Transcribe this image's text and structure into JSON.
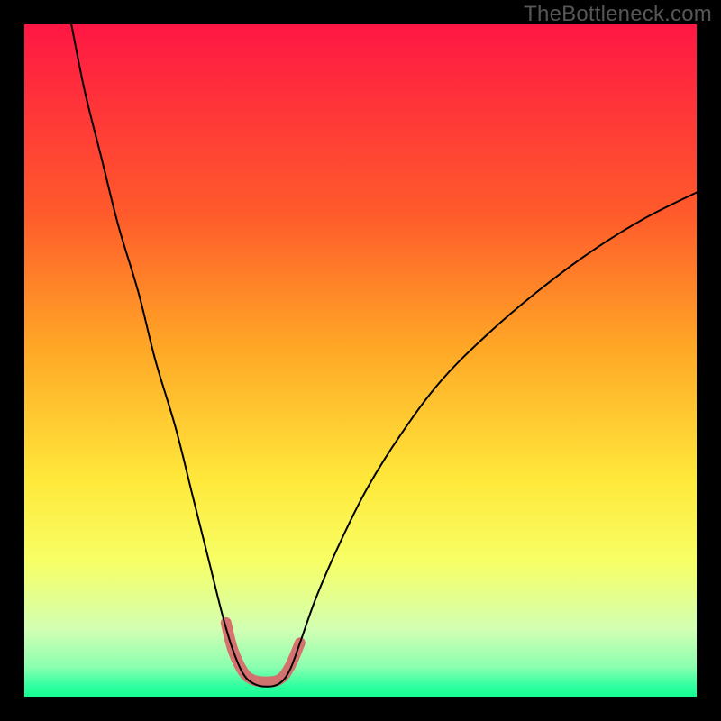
{
  "watermark": "TheBottleneck.com",
  "chart_data": {
    "type": "line",
    "title": "",
    "xlabel": "",
    "ylabel": "",
    "xlim": [
      0,
      100
    ],
    "ylim": [
      0,
      100
    ],
    "gradient_stops": [
      {
        "offset": 0.0,
        "color": "#ff1744"
      },
      {
        "offset": 0.28,
        "color": "#ff5a2b"
      },
      {
        "offset": 0.48,
        "color": "#ffa726"
      },
      {
        "offset": 0.68,
        "color": "#ffe93b"
      },
      {
        "offset": 0.8,
        "color": "#f7ff66"
      },
      {
        "offset": 0.9,
        "color": "#d2ffb3"
      },
      {
        "offset": 0.955,
        "color": "#8cffb0"
      },
      {
        "offset": 0.985,
        "color": "#2effa0"
      },
      {
        "offset": 1.0,
        "color": "#16ff91"
      }
    ],
    "series": [
      {
        "name": "bottleneck-curve",
        "stroke": "#000000",
        "stroke_width": 2,
        "points": [
          {
            "x": 7.0,
            "y": 100.0
          },
          {
            "x": 9.0,
            "y": 90.0
          },
          {
            "x": 11.5,
            "y": 80.0
          },
          {
            "x": 14.0,
            "y": 70.0
          },
          {
            "x": 17.0,
            "y": 60.0
          },
          {
            "x": 19.5,
            "y": 50.0
          },
          {
            "x": 22.5,
            "y": 40.0
          },
          {
            "x": 25.0,
            "y": 30.0
          },
          {
            "x": 27.5,
            "y": 20.0
          },
          {
            "x": 29.5,
            "y": 12.0
          },
          {
            "x": 31.0,
            "y": 7.0
          },
          {
            "x": 32.5,
            "y": 3.5
          },
          {
            "x": 34.0,
            "y": 2.0
          },
          {
            "x": 36.0,
            "y": 1.5
          },
          {
            "x": 38.0,
            "y": 2.0
          },
          {
            "x": 39.5,
            "y": 4.0
          },
          {
            "x": 41.0,
            "y": 8.0
          },
          {
            "x": 43.5,
            "y": 15.0
          },
          {
            "x": 47.0,
            "y": 23.0
          },
          {
            "x": 51.0,
            "y": 31.0
          },
          {
            "x": 56.0,
            "y": 39.0
          },
          {
            "x": 62.0,
            "y": 47.0
          },
          {
            "x": 69.0,
            "y": 54.0
          },
          {
            "x": 76.0,
            "y": 60.0
          },
          {
            "x": 84.0,
            "y": 66.0
          },
          {
            "x": 92.0,
            "y": 71.0
          },
          {
            "x": 100.0,
            "y": 75.0
          }
        ]
      },
      {
        "name": "highlight-band",
        "stroke": "#d86a6a",
        "stroke_width": 12,
        "linecap": "round",
        "points": [
          {
            "x": 30.0,
            "y": 11.0
          },
          {
            "x": 31.0,
            "y": 7.0
          },
          {
            "x": 32.5,
            "y": 3.8
          },
          {
            "x": 34.0,
            "y": 2.5
          },
          {
            "x": 36.0,
            "y": 2.2
          },
          {
            "x": 38.0,
            "y": 2.6
          },
          {
            "x": 39.5,
            "y": 4.5
          },
          {
            "x": 41.0,
            "y": 8.0
          }
        ]
      }
    ]
  }
}
